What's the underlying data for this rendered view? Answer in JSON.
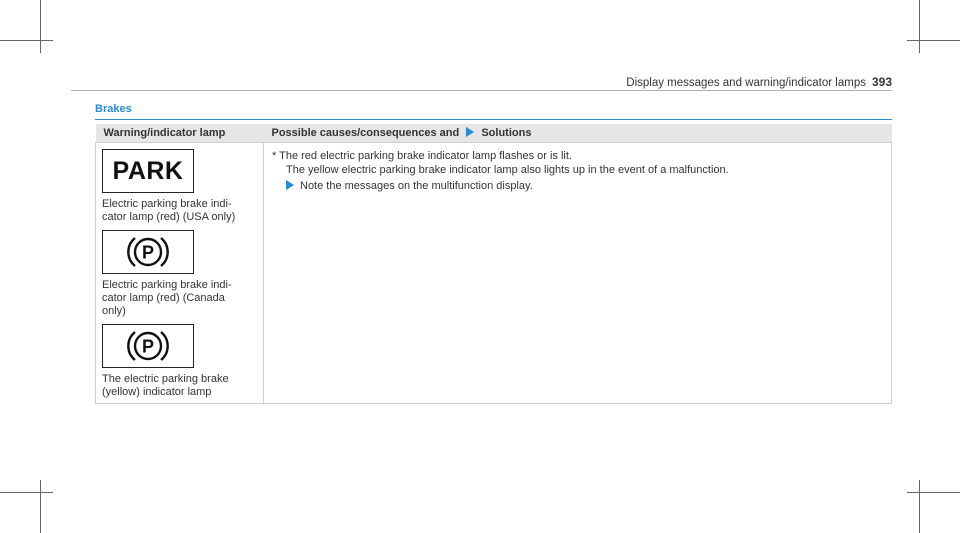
{
  "header": {
    "running_title": "Display messages and warning/indicator lamps",
    "page_number": "393"
  },
  "section": {
    "title": "Brakes"
  },
  "table": {
    "col1_header": "Warning/indicator lamp",
    "col2_header_prefix": "Possible causes/consequences and",
    "col2_header_suffix": "Solutions",
    "lamps": [
      {
        "icon": "park-text-lamp",
        "glyph_text": "PARK",
        "caption": "Electric parking brake indi-\ncator lamp (red) (USA only)"
      },
      {
        "icon": "circle-p-lamp",
        "glyph_text": "P",
        "caption": "Electric parking brake indi-\ncator lamp (red) (Canada\nonly)"
      },
      {
        "icon": "circle-p-lamp",
        "glyph_text": "P",
        "caption": "The electric parking brake\n(yellow) indicator lamp"
      }
    ],
    "body": {
      "line1": "* The red electric parking brake indicator lamp flashes or is lit.",
      "line2": "The yellow electric parking brake indicator lamp also lights up in the event of a malfunction.",
      "action": "Note the messages on the multifunction display."
    }
  },
  "colors": {
    "accent": "#2a8ad0",
    "header_bg": "#e6e6e6",
    "border": "#cfcfcf"
  }
}
